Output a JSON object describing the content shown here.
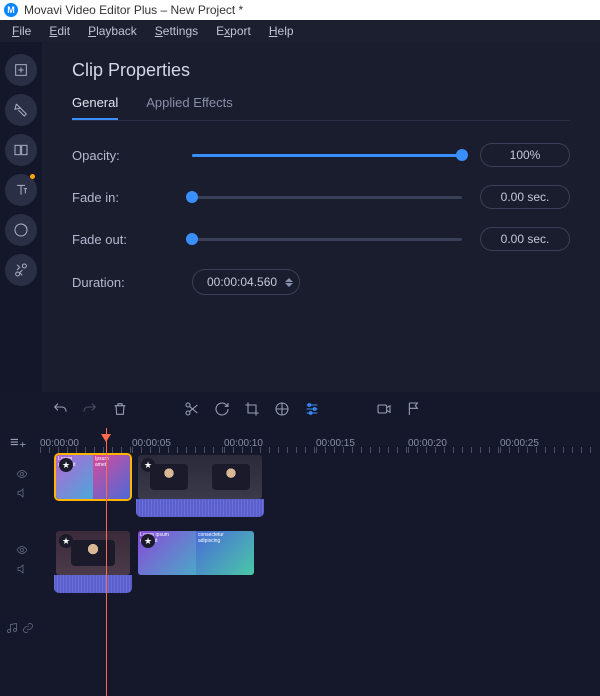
{
  "app": {
    "title": "Movavi Video Editor Plus – New Project *"
  },
  "menu": [
    "File",
    "Edit",
    "Playback",
    "Settings",
    "Export",
    "Help"
  ],
  "panel": {
    "title": "Clip Properties",
    "tabs": {
      "general": "General",
      "effects": "Applied Effects"
    },
    "opacity_label": "Opacity:",
    "opacity_value": "100%",
    "fadein_label": "Fade in:",
    "fadein_value": "0.00 sec.",
    "fadeout_label": "Fade out:",
    "fadeout_value": "0.00 sec.",
    "duration_label": "Duration:",
    "duration_value": "00:00:04.560"
  },
  "ruler": [
    "00:00:00",
    "00:00:05",
    "00:00:10",
    "00:00:15",
    "00:00:20",
    "00:00:25"
  ]
}
